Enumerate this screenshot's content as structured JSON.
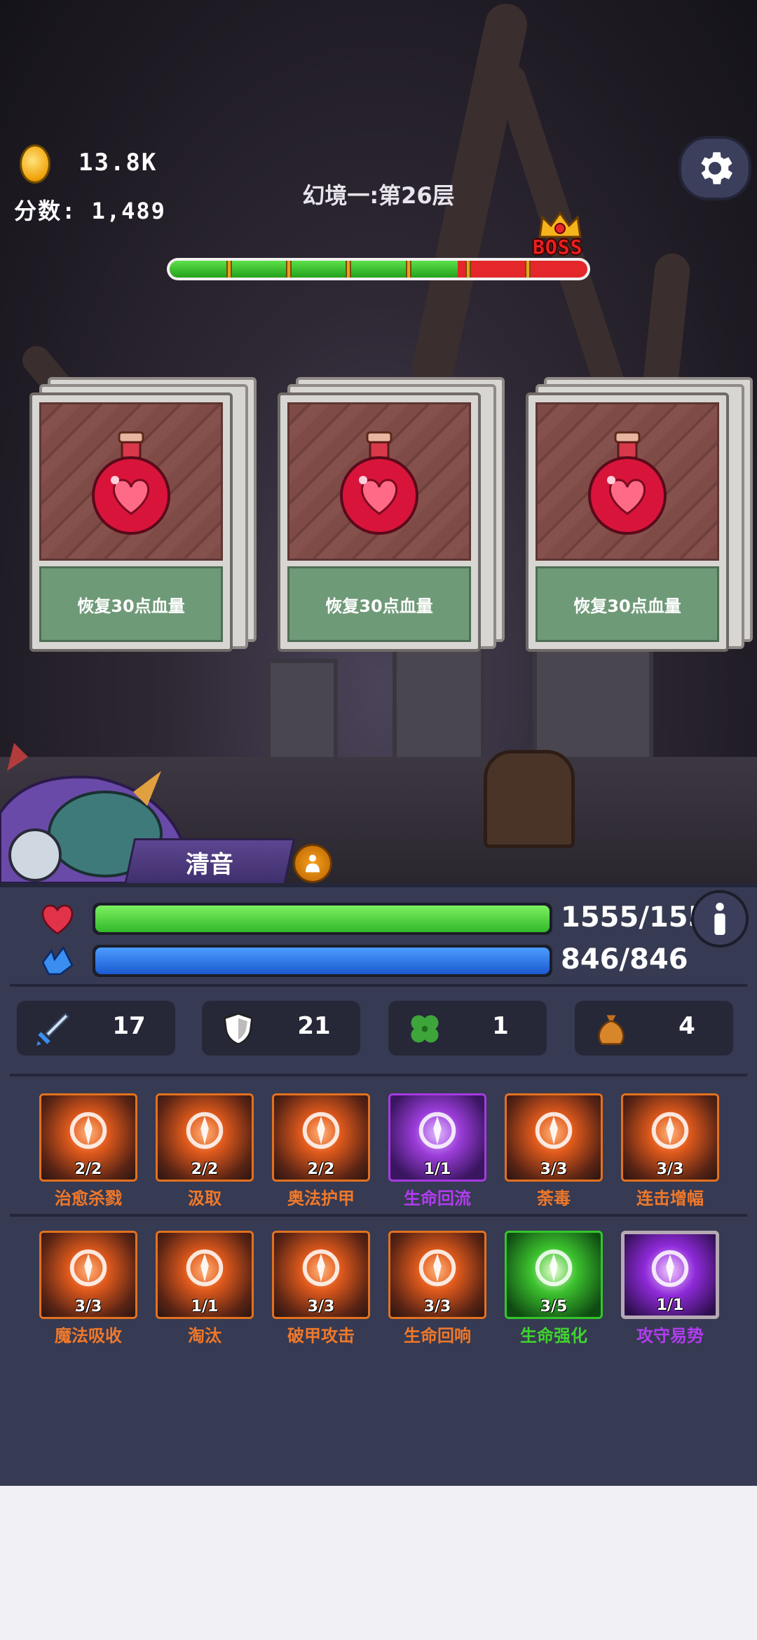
{
  "hud": {
    "coins": "13.8K",
    "score_label": "分数:",
    "score": "1,489",
    "level_title": "幻境一:第26层",
    "boss_label": "BOSS",
    "progress_fraction": 0.69,
    "progress_ticks": 6
  },
  "cards": [
    {
      "label": "恢复30点血量",
      "icon": "heart-potion-icon"
    },
    {
      "label": "恢复30点血量",
      "icon": "heart-potion-icon"
    },
    {
      "label": "恢复30点血量",
      "icon": "heart-potion-icon"
    }
  ],
  "hero": {
    "name": "清音"
  },
  "stats": {
    "hp": "1555/1555",
    "hp_fraction": 1.0,
    "mp": "846/846",
    "mp_fraction": 1.0,
    "attack": "17",
    "defense": "21",
    "luck": "1",
    "bag": "4"
  },
  "skills_row1": [
    {
      "name": "治愈杀戮",
      "count": "2/2",
      "tier": "orange"
    },
    {
      "name": "汲取",
      "count": "2/2",
      "tier": "orange"
    },
    {
      "name": "奥法护甲",
      "count": "2/2",
      "tier": "orange"
    },
    {
      "name": "生命回流",
      "count": "1/1",
      "tier": "purple"
    },
    {
      "name": "荼毒",
      "count": "3/3",
      "tier": "orange"
    },
    {
      "name": "连击增幅",
      "count": "3/3",
      "tier": "orange"
    }
  ],
  "skills_row2": [
    {
      "name": "魔法吸收",
      "count": "3/3",
      "tier": "orange"
    },
    {
      "name": "淘汰",
      "count": "1/1",
      "tier": "orange"
    },
    {
      "name": "破甲攻击",
      "count": "3/3",
      "tier": "orange"
    },
    {
      "name": "生命回响",
      "count": "3/3",
      "tier": "orange"
    },
    {
      "name": "生命强化",
      "count": "3/5",
      "tier": "green"
    },
    {
      "name": "攻守易势",
      "count": "1/1",
      "tier": "violet"
    }
  ],
  "colors": {
    "orange_name": "#f0782a",
    "purple_name": "#b23cf0",
    "green_name": "#3fd42e",
    "violet_name": "#b23cf0",
    "hp_bar": "#3fcf2e",
    "mp_bar": "#2a7ae4",
    "panel_bg": "#363a52"
  }
}
